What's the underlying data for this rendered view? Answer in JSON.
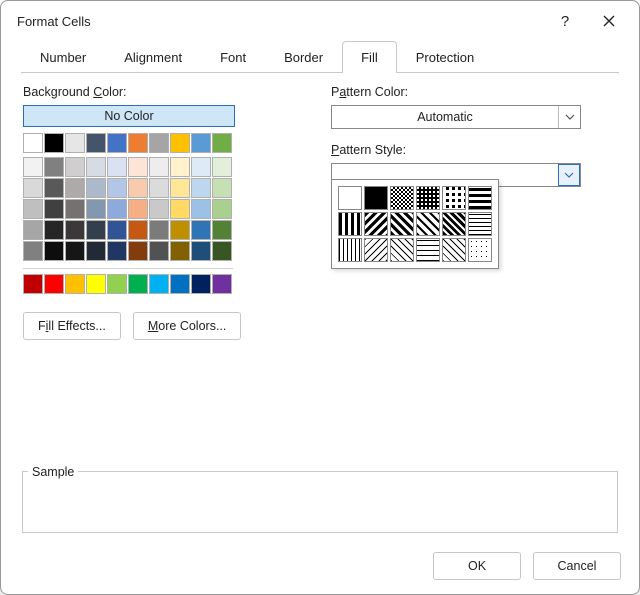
{
  "dialog": {
    "title": "Format Cells"
  },
  "tabs": {
    "number": "Number",
    "alignment": "Alignment",
    "font": "Font",
    "border": "Border",
    "fill": "Fill",
    "protection": "Protection",
    "active": "fill"
  },
  "fill": {
    "bg_label_pre": "Background ",
    "bg_label_u": "C",
    "bg_label_post": "olor:",
    "no_color": "No Color",
    "fill_effects_pre": "F",
    "fill_effects_u": "i",
    "fill_effects_post": "ll Effects...",
    "more_colors_u": "M",
    "more_colors_post": "ore Colors...",
    "pattern_color_pre": "P",
    "pattern_color_u": "a",
    "pattern_color_post": "ttern Color:",
    "pattern_color_value": "Automatic",
    "pattern_style_u": "P",
    "pattern_style_post": "attern Style:"
  },
  "palette_theme": [
    "#FFFFFF",
    "#000000",
    "#E7E6E6",
    "#44546A",
    "#4472C4",
    "#ED7D31",
    "#A5A5A5",
    "#FFC000",
    "#5B9BD5",
    "#70AD47"
  ],
  "palette_tints": [
    [
      "#F2F2F2",
      "#808080",
      "#D0CECE",
      "#D6DCE4",
      "#D9E1F2",
      "#FCE4D6",
      "#EDEDED",
      "#FFF2CC",
      "#DDEBF7",
      "#E2EFDA"
    ],
    [
      "#D9D9D9",
      "#595959",
      "#AEAAAA",
      "#ACB9CA",
      "#B4C6E7",
      "#F8CBAD",
      "#DBDBDB",
      "#FFE699",
      "#BDD7EE",
      "#C6E0B4"
    ],
    [
      "#BFBFBF",
      "#404040",
      "#757171",
      "#8497B0",
      "#8EA9DB",
      "#F4B084",
      "#C9C9C9",
      "#FFD966",
      "#9BC2E6",
      "#A9D08E"
    ],
    [
      "#A6A6A6",
      "#262626",
      "#3A3838",
      "#333F4F",
      "#305496",
      "#C65911",
      "#7B7B7B",
      "#BF8F00",
      "#2F75B5",
      "#548235"
    ],
    [
      "#808080",
      "#0D0D0D",
      "#161616",
      "#222B35",
      "#203764",
      "#833C0C",
      "#525252",
      "#806000",
      "#1F4E78",
      "#375623"
    ]
  ],
  "palette_standard": [
    "#C00000",
    "#FF0000",
    "#FFC000",
    "#FFFF00",
    "#92D050",
    "#00B050",
    "#00B0F0",
    "#0070C0",
    "#002060",
    "#7030A0"
  ],
  "patterns": [
    "none",
    "solid",
    "gray50",
    "gray75",
    "gray25",
    "horz-stripe",
    "vert-stripe",
    "rev-diag",
    "diag",
    "diag-cross",
    "thick-diag-cross",
    "thin-horz",
    "thin-vert",
    "thin-rev-diag",
    "thin-diag",
    "thin-horz-cross",
    "thin-diag-cross",
    "gray12"
  ],
  "sample_label": "Sample",
  "footer": {
    "ok": "OK",
    "cancel": "Cancel"
  }
}
